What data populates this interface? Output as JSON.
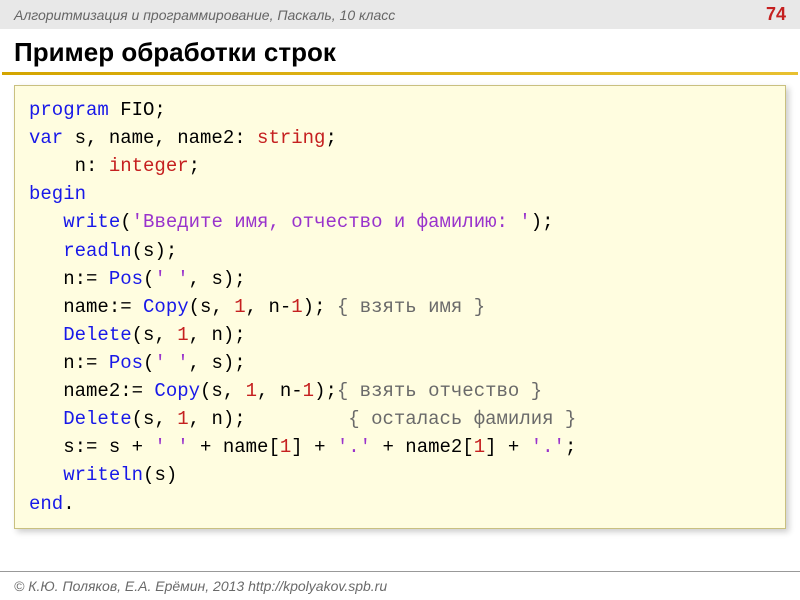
{
  "header": {
    "breadcrumb": "Алгоритмизация и программирование, Паскаль, 10 класс",
    "page_number": "74"
  },
  "title": "Пример обработки строк",
  "code": {
    "l1_kw": "program ",
    "l1_id": "FIO;",
    "l2_kw": "var ",
    "l2_rest": "s, name, name2: ",
    "l2_ty": "string",
    "l2_end": ";",
    "l3_pad": "    n: ",
    "l3_ty": "integer",
    "l3_end": ";",
    "l4_kw": "begin",
    "l5_pad": "   ",
    "l5_kw": "write",
    "l5_open": "(",
    "l5_str": "'Введите имя, отчество и фамилию: '",
    "l5_close": ");",
    "l6_pad": "   ",
    "l6_kw": "readln",
    "l6_rest": "(s);",
    "l7_pad": "   n:= ",
    "l7_fn": "Pos",
    "l7_open": "(",
    "l7_str": "' '",
    "l7_rest": ", s);",
    "l8_pad": "   name:= ",
    "l8_fn": "Copy",
    "l8_open": "(s, ",
    "l8_n1": "1",
    "l8_mid": ", n-",
    "l8_n2": "1",
    "l8_close": "); ",
    "l8_cmt": "{ взять имя }",
    "l9_pad": "   ",
    "l9_fn": "Delete",
    "l9_open": "(s, ",
    "l9_n1": "1",
    "l9_rest": ", n);",
    "l10_pad": "   n:= ",
    "l10_fn": "Pos",
    "l10_open": "(",
    "l10_str": "' '",
    "l10_rest": ", s);",
    "l11_pad": "   name2:= ",
    "l11_fn": "Copy",
    "l11_open": "(s, ",
    "l11_n1": "1",
    "l11_mid": ", n-",
    "l11_n2": "1",
    "l11_close": ");",
    "l11_cmt": "{ взять отчество }",
    "l12_pad": "   ",
    "l12_fn": "Delete",
    "l12_open": "(s, ",
    "l12_n1": "1",
    "l12_rest": ", n);         ",
    "l12_cmt": "{ осталась фамилия }",
    "l13_pad": "   s:= s + ",
    "l13_s1": "' '",
    "l13_a": " + name[",
    "l13_n1": "1",
    "l13_b": "] + ",
    "l13_s2": "'.'",
    "l13_c": " + name2[",
    "l13_n2": "1",
    "l13_d": "] + ",
    "l13_s3": "'.'",
    "l13_e": ";",
    "l14_pad": "   ",
    "l14_kw": "writeln",
    "l14_rest": "(s)",
    "l15_kw": "end",
    "l15_rest": "."
  },
  "footer": "© К.Ю. Поляков, Е.А. Ерёмин, 2013    http://kpolyakov.spb.ru"
}
